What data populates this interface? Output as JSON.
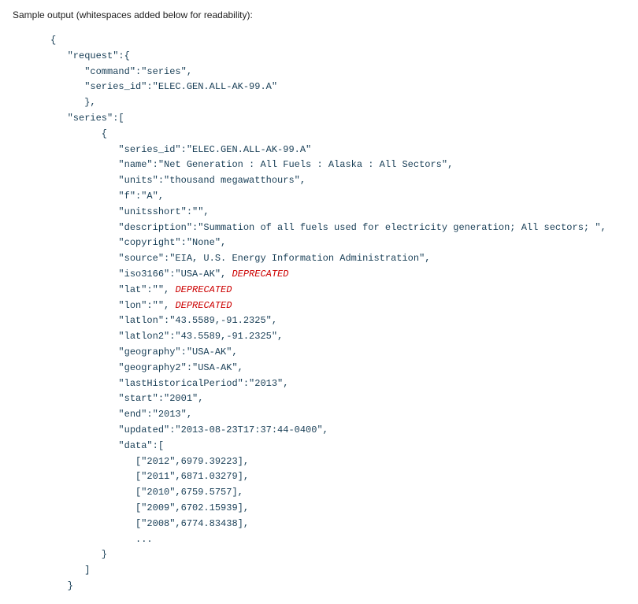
{
  "caption": "Sample output (whitespaces added below for readability):",
  "deprecatedLabel": "DEPRECATED",
  "code": {
    "l1": "{",
    "l2": "   \"request\":{",
    "l3": "      \"command\":\"series\",",
    "l4": "      \"series_id\":\"ELEC.GEN.ALL-AK-99.A\"",
    "l5": "      },",
    "l6": "   \"series\":[",
    "l7": "         {",
    "l8": "            \"series_id\":\"ELEC.GEN.ALL-AK-99.A\"",
    "l9": "            \"name\":\"Net Generation : All Fuels : Alaska : All Sectors\",",
    "l10": "            \"units\":\"thousand megawatthours\",",
    "l11": "            \"f\":\"A\",",
    "l12": "            \"unitsshort\":\"\",",
    "l13": "            \"description\":\"Summation of all fuels used for electricity generation; All sectors; \",",
    "l14": "            \"copyright\":\"None\",",
    "l15": "            \"source\":\"EIA, U.S. Energy Information Administration\",",
    "l16a": "            \"iso3166\":\"USA-AK\", ",
    "l17a": "            \"lat\":\"\", ",
    "l18a": "            \"lon\":\"\", ",
    "l19": "            \"latlon\":\"43.5589,-91.2325\",",
    "l20": "            \"latlon2\":\"43.5589,-91.2325\",",
    "l21": "            \"geography\":\"USA-AK\",",
    "l22": "            \"geography2\":\"USA-AK\",",
    "l23": "            \"lastHistoricalPeriod\":\"2013\",",
    "l24": "            \"start\":\"2001\",",
    "l25": "            \"end\":\"2013\",",
    "l26": "            \"updated\":\"2013-08-23T17:37:44-0400\",",
    "l27": "            \"data\":[",
    "l28": "               [\"2012\",6979.39223],",
    "l29": "               [\"2011\",6871.03279],",
    "l30": "               [\"2010\",6759.5757],",
    "l31": "               [\"2009\",6702.15939],",
    "l32": "               [\"2008\",6774.83438],",
    "l33": "               ...",
    "l34": "         }",
    "l35": "      ]",
    "l36": "   }"
  }
}
